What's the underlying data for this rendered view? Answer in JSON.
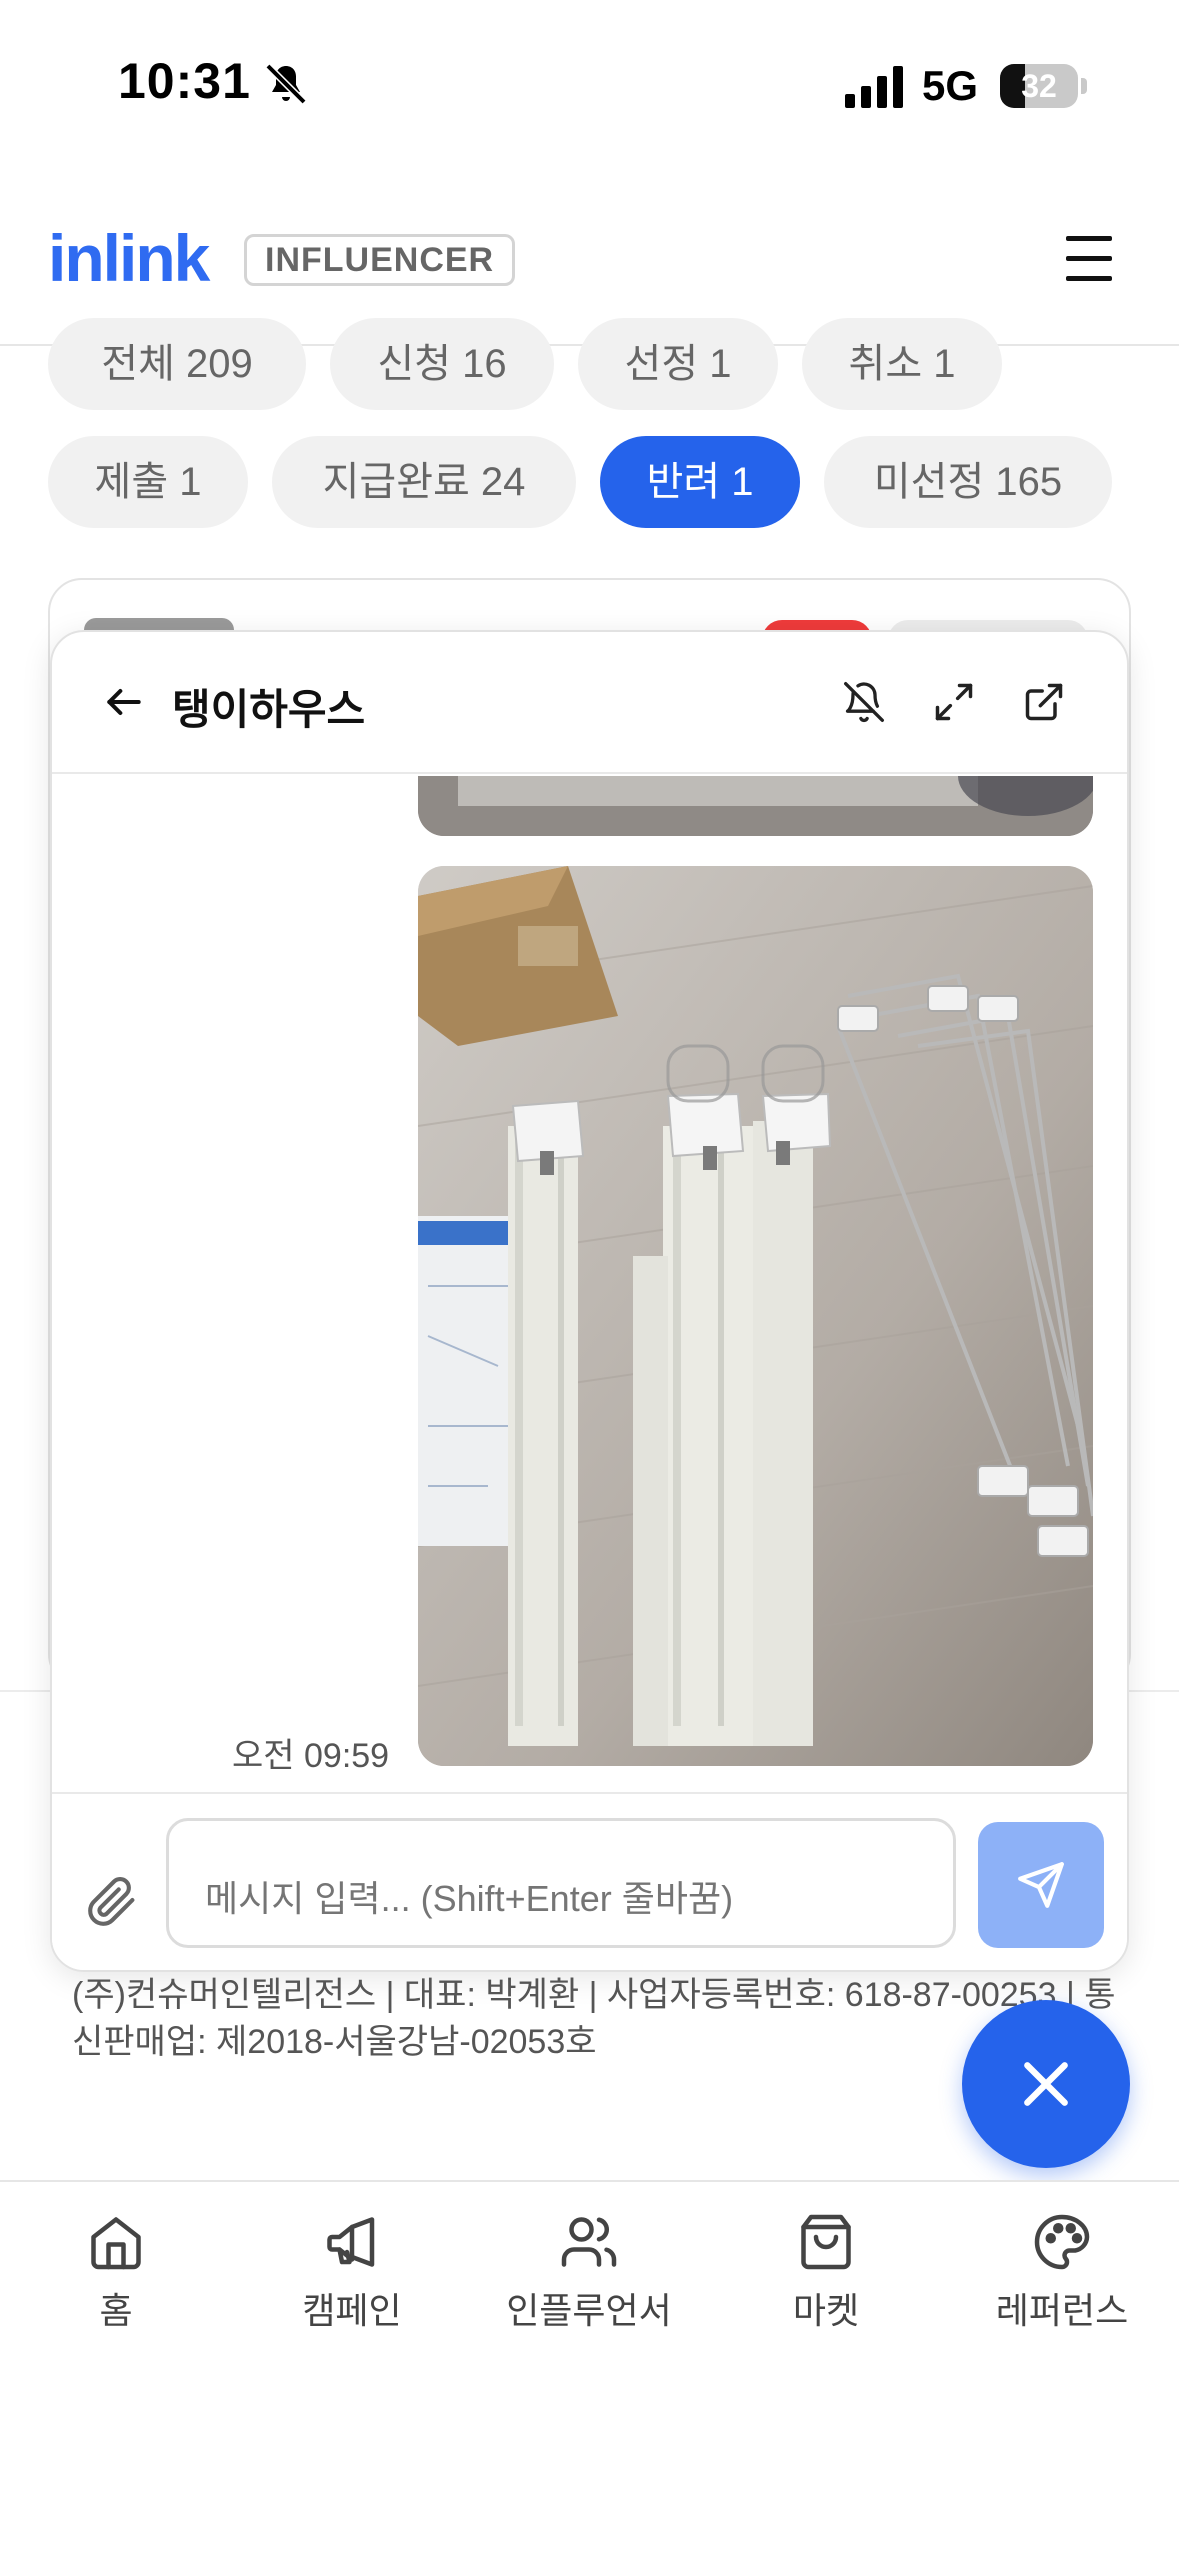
{
  "status_bar": {
    "time": "10:31",
    "network": "5G",
    "battery_level": "32",
    "battery_percent": 32
  },
  "header": {
    "logo": "inlink",
    "role_badge": "INFLUENCER"
  },
  "filters": [
    {
      "label": "전체 209",
      "active": false
    },
    {
      "label": "신청 16",
      "active": false
    },
    {
      "label": "선정 1",
      "active": false
    },
    {
      "label": "취소 1",
      "active": false
    },
    {
      "label": "제출 1",
      "active": false
    },
    {
      "label": "지급완료 24",
      "active": false
    },
    {
      "label": "반려 1",
      "active": true
    },
    {
      "label": "미선정 165",
      "active": false
    }
  ],
  "chat": {
    "title": "탱이하우스",
    "messages": [
      {
        "type": "image",
        "description_icon": "photo"
      },
      {
        "type": "image",
        "time": "오전 09:59"
      }
    ],
    "input_placeholder": "메시지 입력... (Shift+Enter 줄바꿈)"
  },
  "company_info": "(주)컨슈머인텔리전스 | 대표: 박계환 | 사업자등록번호: 618-87-00253 | 통신판매업: 제2018-서울강남-02053호",
  "bottom_nav": [
    {
      "label": "홈",
      "icon": "home-icon"
    },
    {
      "label": "캠페인",
      "icon": "megaphone-icon"
    },
    {
      "label": "인플루언서",
      "icon": "users-icon"
    },
    {
      "label": "마켓",
      "icon": "shopping-bag-icon"
    },
    {
      "label": "레퍼런스",
      "icon": "palette-icon"
    }
  ],
  "colors": {
    "accent": "#2563eb",
    "send_button": "#8db1f7",
    "chip_bg": "#f1f1f1"
  }
}
